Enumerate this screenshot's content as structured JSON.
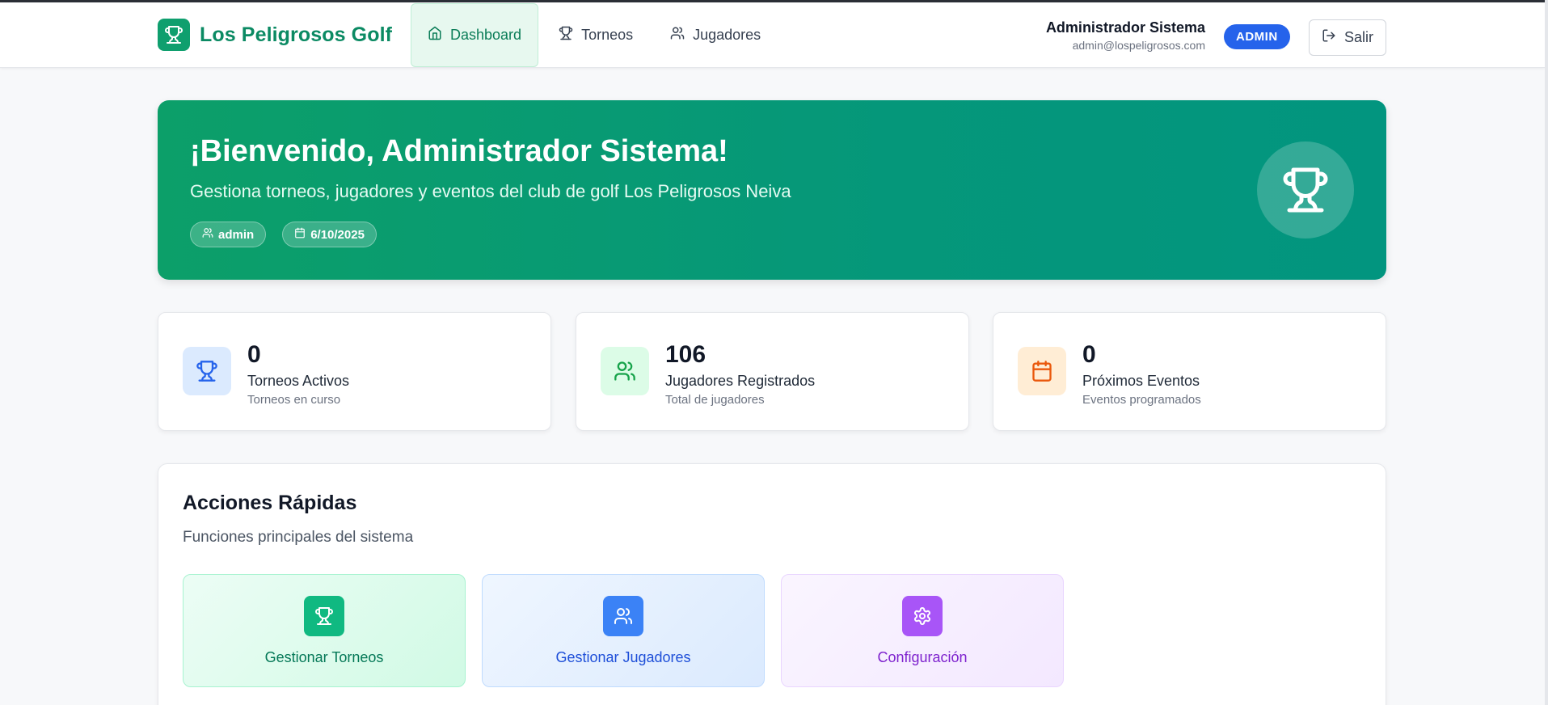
{
  "app": {
    "brand": "Los Peligrosos Golf",
    "brand_color": "#0b8a63"
  },
  "nav": {
    "items": [
      {
        "label": "Dashboard",
        "icon": "home-icon",
        "active": true
      },
      {
        "label": "Torneos",
        "icon": "trophy-icon",
        "active": false
      },
      {
        "label": "Jugadores",
        "icon": "users-icon",
        "active": false
      }
    ]
  },
  "user": {
    "name": "Administrador Sistema",
    "email": "admin@lospeligrosos.com",
    "role": "ADMIN",
    "logout_label": "Salir"
  },
  "hero": {
    "title": "¡Bienvenido, Administrador Sistema!",
    "subtitle": "Gestiona torneos, jugadores y eventos del club de golf Los Peligrosos Neiva",
    "chip_user": "admin",
    "chip_date": "6/10/2025"
  },
  "stats": [
    {
      "value": "0",
      "label": "Torneos Activos",
      "sub": "Torneos en curso",
      "icon": "trophy-icon",
      "color": "#2563eb"
    },
    {
      "value": "106",
      "label": "Jugadores Registrados",
      "sub": "Total de jugadores",
      "icon": "users-icon",
      "color": "#16a34a"
    },
    {
      "value": "0",
      "label": "Próximos Eventos",
      "sub": "Eventos programados",
      "icon": "calendar-icon",
      "color": "#ea580c"
    }
  ],
  "quick_actions": {
    "title": "Acciones Rápidas",
    "subtitle": "Funciones principales del sistema",
    "items": [
      {
        "label": "Gestionar Torneos",
        "icon": "trophy-icon",
        "color": "#047857"
      },
      {
        "label": "Gestionar Jugadores",
        "icon": "users-icon",
        "color": "#1d4ed8"
      },
      {
        "label": "Configuración",
        "icon": "gear-icon",
        "color": "#7e22ce"
      }
    ]
  }
}
